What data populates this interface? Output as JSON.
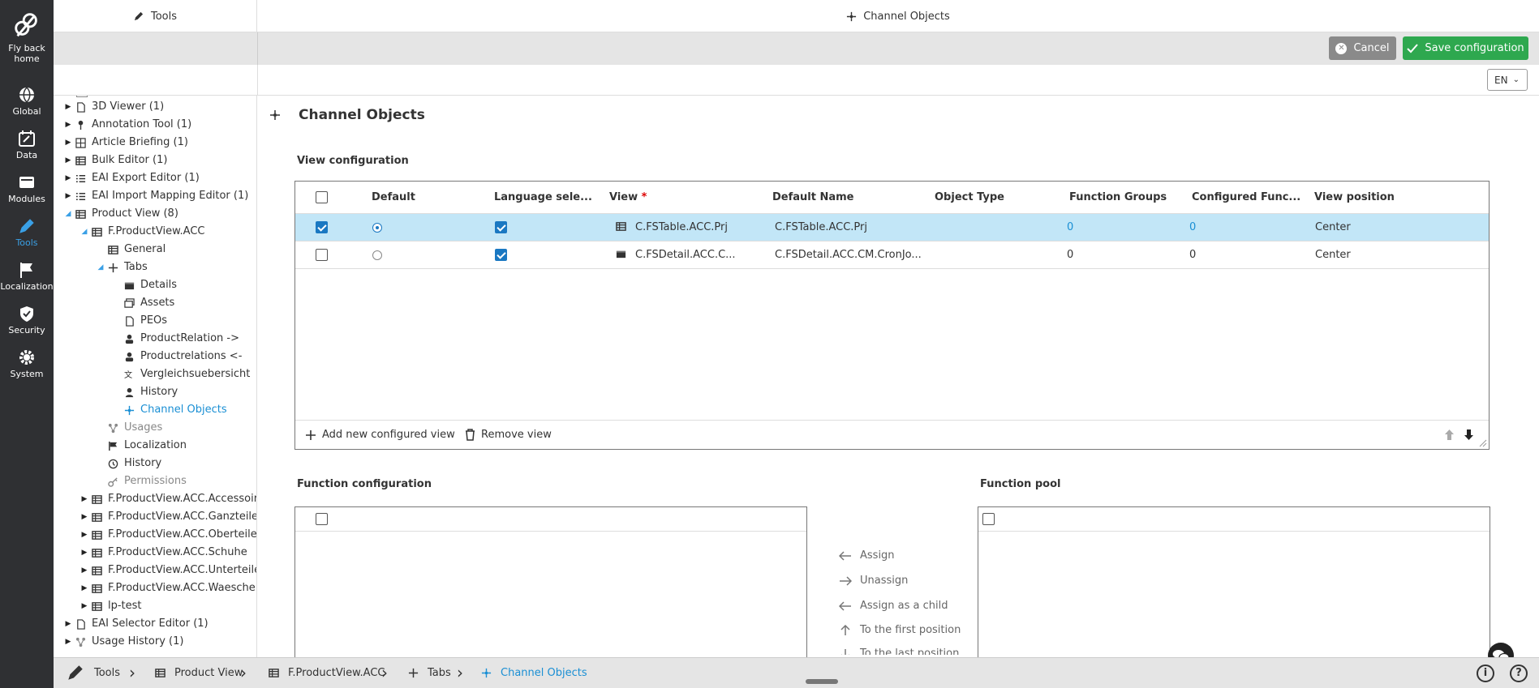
{
  "rail": [
    {
      "label": "Fly back home",
      "icon": "bee-logo-icon"
    },
    {
      "label": "Global",
      "icon": "globe-icon"
    },
    {
      "label": "Data",
      "icon": "calendar-edit-icon"
    },
    {
      "label": "Modules",
      "icon": "modules-icon"
    },
    {
      "label": "Tools",
      "icon": "pencil-icon",
      "active": true
    },
    {
      "label": "Localization",
      "icon": "flag-icon"
    },
    {
      "label": "Security",
      "icon": "shield-icon"
    },
    {
      "label": "System",
      "icon": "gear-icon"
    }
  ],
  "header": {
    "left_title": "Tools",
    "center_title": "Channel Objects",
    "cancel_label": "Cancel",
    "save_label": "Save configuration",
    "language": "EN"
  },
  "tree": [
    {
      "label": "3D Viewer (1)",
      "level": 0,
      "state": "closed",
      "icon": "file-icon"
    },
    {
      "label": "Annotation Tool (1)",
      "level": 0,
      "state": "closed",
      "icon": "pin-icon"
    },
    {
      "label": "Article Briefing (1)",
      "level": 0,
      "state": "closed",
      "icon": "grid-icon"
    },
    {
      "label": "Bulk Editor (1)",
      "level": 0,
      "state": "closed",
      "icon": "table-icon"
    },
    {
      "label": "EAI Export Editor (1)",
      "level": 0,
      "state": "closed",
      "icon": "list-icon"
    },
    {
      "label": "EAI Import Mapping Editor (1)",
      "level": 0,
      "state": "closed",
      "icon": "list-icon"
    },
    {
      "label": "Product View (8)",
      "level": 0,
      "state": "open",
      "icon": "table-icon"
    },
    {
      "label": "F.ProductView.ACC",
      "level": 1,
      "state": "open",
      "icon": "table-icon"
    },
    {
      "label": "General",
      "level": 2,
      "state": "none",
      "icon": "table-icon"
    },
    {
      "label": "Tabs",
      "level": 2,
      "state": "open",
      "icon": "plus-icon"
    },
    {
      "label": "Details",
      "level": 3,
      "state": "none",
      "icon": "detail-icon"
    },
    {
      "label": "Assets",
      "level": 3,
      "state": "none",
      "icon": "assets-icon"
    },
    {
      "label": "PEOs",
      "level": 3,
      "state": "none",
      "icon": "file-icon"
    },
    {
      "label": "ProductRelation ->",
      "level": 3,
      "state": "none",
      "icon": "relation-icon"
    },
    {
      "label": "Productrelations <-",
      "level": 3,
      "state": "none",
      "icon": "relation-icon"
    },
    {
      "label": "Vergleichsuebersicht",
      "level": 3,
      "state": "none",
      "icon": "translate-icon"
    },
    {
      "label": "History",
      "level": 3,
      "state": "none",
      "icon": "user-icon"
    },
    {
      "label": "Channel Objects",
      "level": 3,
      "state": "none",
      "icon": "channel-icon",
      "selected": true
    },
    {
      "label": "Usages",
      "level": 2,
      "state": "none",
      "icon": "usages-icon",
      "muted": true
    },
    {
      "label": "Localization",
      "level": 2,
      "state": "none",
      "icon": "flag-icon"
    },
    {
      "label": "History",
      "level": 2,
      "state": "none",
      "icon": "history-icon"
    },
    {
      "label": "Permissions",
      "level": 2,
      "state": "none",
      "icon": "key-icon",
      "muted": true
    },
    {
      "label": "F.ProductView.ACC.Accessoir.",
      "level": 1,
      "state": "closed",
      "icon": "table-icon"
    },
    {
      "label": "F.ProductView.ACC.Ganzteile",
      "level": 1,
      "state": "closed",
      "icon": "table-icon"
    },
    {
      "label": "F.ProductView.ACC.Oberteile",
      "level": 1,
      "state": "closed",
      "icon": "table-icon"
    },
    {
      "label": "F.ProductView.ACC.Schuhe",
      "level": 1,
      "state": "closed",
      "icon": "table-icon"
    },
    {
      "label": "F.ProductView.ACC.Unterteile",
      "level": 1,
      "state": "closed",
      "icon": "table-icon"
    },
    {
      "label": "F.ProductView.ACC.Waesche",
      "level": 1,
      "state": "closed",
      "icon": "table-icon"
    },
    {
      "label": "lp-test",
      "level": 1,
      "state": "closed",
      "icon": "table-icon"
    },
    {
      "label": "EAI Selector Editor (1)",
      "level": 0,
      "state": "closed",
      "icon": "file-icon"
    },
    {
      "label": "Usage History (1)",
      "level": 0,
      "state": "closed",
      "icon": "usages-icon"
    }
  ],
  "main": {
    "title": "Channel Objects",
    "view_config_label": "View configuration",
    "columns": {
      "default": "Default",
      "language": "Language sele...",
      "view": "View",
      "required_mark": "*",
      "default_name": "Default Name",
      "object_type": "Object Type",
      "function_groups": "Function Groups",
      "configured": "Configured Func...",
      "position": "View position"
    },
    "rows": [
      {
        "checked": true,
        "default": true,
        "language": true,
        "view": "C.FSTable.ACC.Prj",
        "view_icon": "table-icon",
        "default_name": "C.FSTable.ACC.Prj",
        "object_type": "",
        "function_groups": "0",
        "configured": "0",
        "position": "Center",
        "selected": true
      },
      {
        "checked": false,
        "default": false,
        "language": true,
        "view": "C.FSDetail.ACC.C...",
        "view_icon": "detail-icon",
        "default_name": "C.FSDetail.ACC.CM.CronJo...",
        "object_type": "",
        "function_groups": "0",
        "configured": "0",
        "position": "Center",
        "selected": false
      }
    ],
    "add_view_label": "Add new configured view",
    "remove_view_label": "Remove view",
    "function_config_label": "Function configuration",
    "function_pool_label": "Function pool",
    "mid_actions": [
      "Assign",
      "Unassign",
      "Assign as a child",
      "To the first position",
      "To the last position"
    ]
  },
  "breadcrumb": [
    {
      "label": "Tools",
      "icon": "pencil-icon"
    },
    {
      "label": "Product View",
      "icon": "table-icon"
    },
    {
      "label": "F.ProductView.ACC",
      "icon": "table-icon"
    },
    {
      "label": "Tabs",
      "icon": "plus-icon"
    },
    {
      "label": "Channel Objects",
      "icon": "channel-icon",
      "selected": true
    }
  ],
  "bottom_buttons": {
    "info": "i",
    "help": "?"
  }
}
